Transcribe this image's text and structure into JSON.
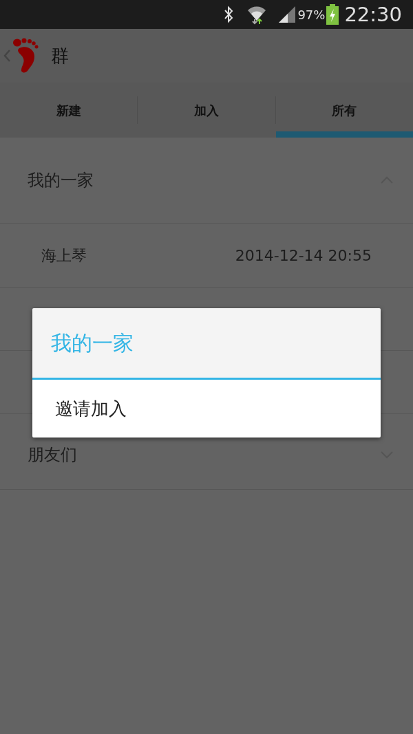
{
  "status_bar": {
    "battery": "97%",
    "time": "22:30"
  },
  "app_bar": {
    "title": "群"
  },
  "tabs": [
    {
      "label": "新建",
      "selected": false
    },
    {
      "label": "加入",
      "selected": false
    },
    {
      "label": "所有",
      "selected": true
    }
  ],
  "groups": [
    {
      "name": "我的一家",
      "expanded": true,
      "members": [
        {
          "name": "海上琴",
          "time": "2014-12-14 20:55"
        }
      ]
    },
    {
      "name": "朋友们",
      "expanded": false
    }
  ],
  "dialog": {
    "title": "我的一家",
    "items": [
      "邀请加入"
    ]
  }
}
